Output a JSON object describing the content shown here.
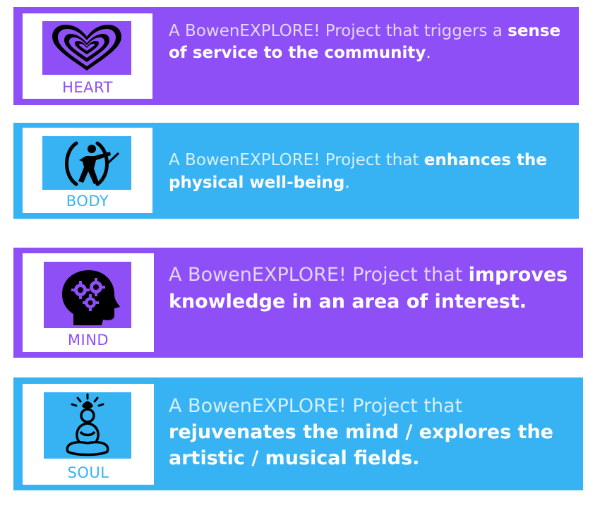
{
  "banners": {
    "heart": {
      "label": "HEART",
      "icon": "heart-icon",
      "lead": "A BowenEXPLORE! Project that triggers a ",
      "emphasis": "sense of service to the community",
      "end": "."
    },
    "body": {
      "label": "BODY",
      "icon": "archer-icon",
      "lead": "A BowenEXPLORE! Project that ",
      "emphasis": "enhances the physical well-being",
      "end": "."
    },
    "mind": {
      "label": "MIND",
      "icon": "head-gears-icon",
      "lead": "A BowenEXPLORE! Project that ",
      "emphasis": "improves knowledge in an area of interest.",
      "end": ""
    },
    "soul": {
      "label": "SOUL",
      "icon": "meditation-icon",
      "lead": "A BowenEXPLORE! Project that ",
      "emphasis": "rejuvenates the mind / explores the artistic / musical fields.",
      "end": ""
    }
  },
  "colors": {
    "purple": "#8f4ff7",
    "blue": "#37b3f3",
    "white": "#ffffff",
    "black": "#000000"
  }
}
